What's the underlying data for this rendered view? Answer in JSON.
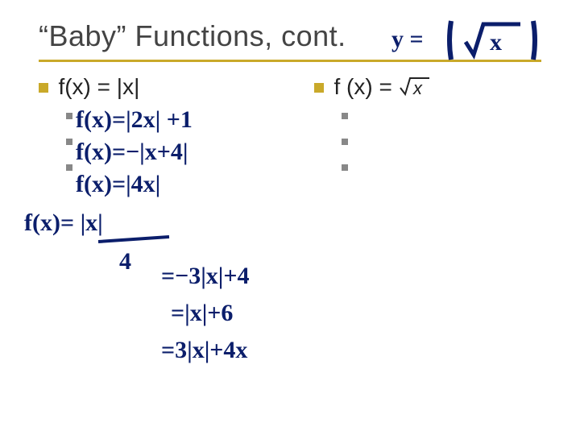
{
  "title": "“Baby” Functions, cont.",
  "left": {
    "header": "f(x) = |x|"
  },
  "right": {
    "header_prefix": "f (x) = ",
    "header_radicand": "x"
  },
  "annotations": {
    "top_right": {
      "prefix": "y =",
      "radicand": "x"
    },
    "l1": "f(x)=|2x| +1",
    "l2": "f(x)=−|x+4|",
    "l3": "f(x)=|4x|",
    "frac_top": "f(x)= |x|",
    "frac_bottom": "4",
    "e1": "=−3|x|+4",
    "e2": "=|x|+6",
    "e3": "=3|x|+4x"
  }
}
